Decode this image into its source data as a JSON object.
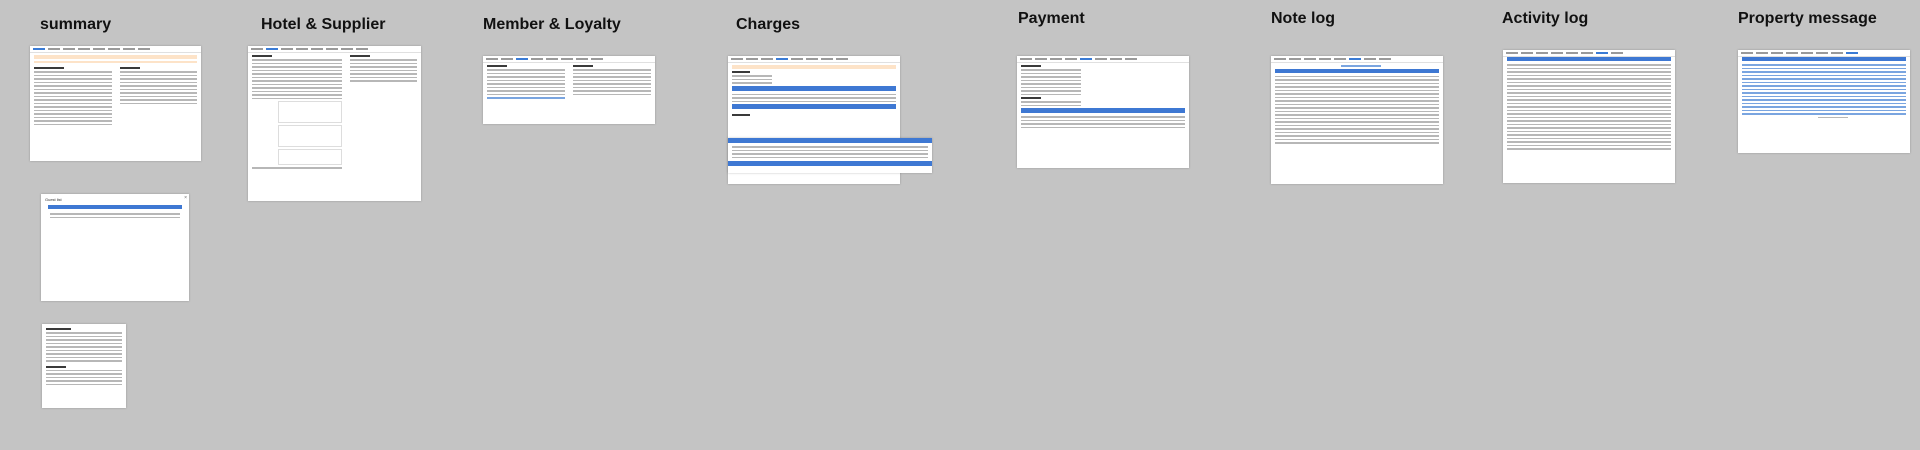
{
  "sections": [
    {
      "id": "summary",
      "title": "summary"
    },
    {
      "id": "hotel",
      "title": "Hotel & Supplier"
    },
    {
      "id": "member",
      "title": "Member & Loyalty"
    },
    {
      "id": "charges",
      "title": "Charges"
    },
    {
      "id": "payment",
      "title": "Payment"
    },
    {
      "id": "notelog",
      "title": "Note log"
    },
    {
      "id": "activity",
      "title": "Activity log"
    },
    {
      "id": "property",
      "title": "Property message"
    }
  ],
  "dialog": {
    "title": "Guest list",
    "close_icon": "close-icon"
  },
  "colors": {
    "background": "#c4c4c4",
    "accent": "#3e78d3",
    "warning": "#fde3c8"
  }
}
